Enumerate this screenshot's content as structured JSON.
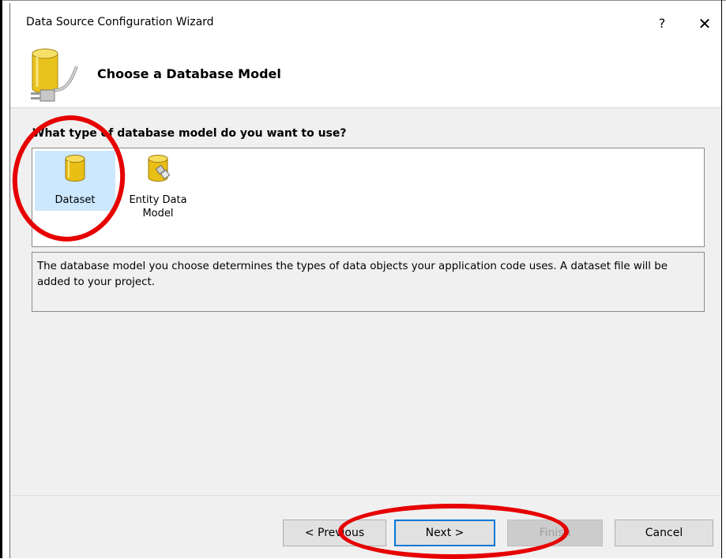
{
  "window": {
    "title": "Data Source Configuration Wizard",
    "help_glyph": "?",
    "close_glyph": "✕"
  },
  "header": {
    "title": "Choose a Database Model",
    "icon": "database-plug-icon"
  },
  "content": {
    "question": "What type of database model do you want to use?",
    "models": [
      {
        "label": "Dataset",
        "icon": "database-icon",
        "selected": true
      },
      {
        "label_line1": "Entity Data",
        "label_line2": "Model",
        "icon": "entity-model-icon",
        "selected": false
      }
    ],
    "description": "The database model you choose determines the types of data objects your application code uses. A dataset file will be added to your project."
  },
  "buttons": {
    "previous": "< Previous",
    "next": "Next >",
    "finish": "Finish",
    "cancel": "Cancel"
  },
  "colors": {
    "selection": "#cce8ff",
    "annotation": "#e60000",
    "focus_border": "#0078d7"
  }
}
